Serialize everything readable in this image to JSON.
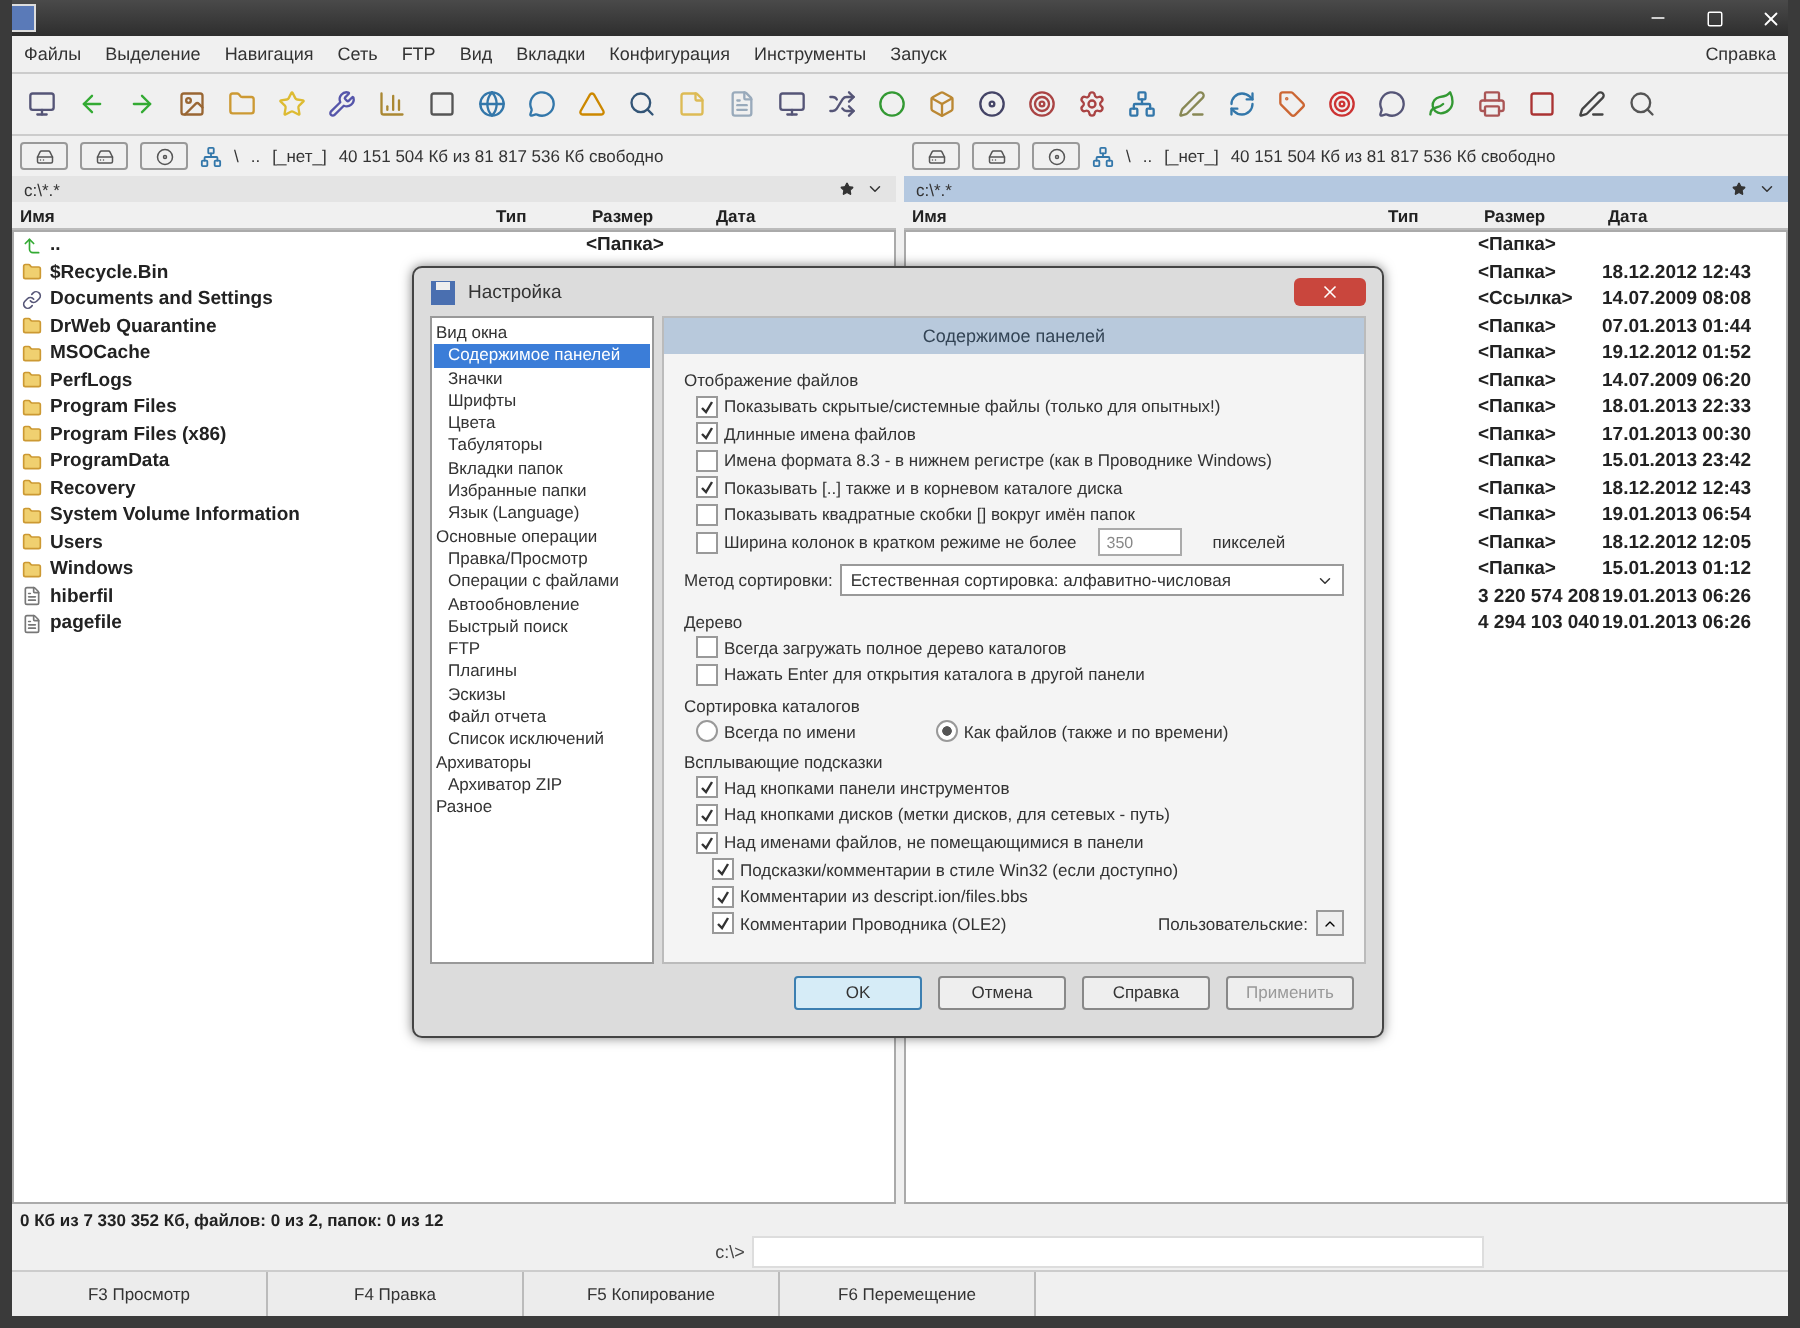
{
  "menu": [
    {
      "label": "Файлы"
    },
    {
      "label": "Выделение"
    },
    {
      "label": "Навигация"
    },
    {
      "label": "Сеть"
    },
    {
      "label": "FTP"
    },
    {
      "label": "Вид"
    },
    {
      "label": "Вкладки"
    },
    {
      "label": "Конфигурация"
    },
    {
      "label": "Инструменты"
    },
    {
      "label": "Запуск"
    }
  ],
  "help_menu": "Справка",
  "panels": [
    {
      "active": false,
      "no_drive": "[_нет_]",
      "root": "\\",
      "up": "..",
      "free": "40 151 504 Кб из 81 817 536 Кб свободно",
      "path": "c:\\*.*",
      "columns": [
        "Имя",
        "Тип",
        "Размер",
        "Дата"
      ],
      "rows": [
        {
          "kind": "up",
          "name": "..",
          "size": "<Папка>"
        },
        {
          "kind": "folder",
          "name": "$Recycle.Bin"
        },
        {
          "kind": "link",
          "name": "Documents and Settings"
        },
        {
          "kind": "folder",
          "name": "DrWeb Quarantine"
        },
        {
          "kind": "folder",
          "name": "MSOCache"
        },
        {
          "kind": "folder",
          "name": "PerfLogs"
        },
        {
          "kind": "folder",
          "name": "Program Files"
        },
        {
          "kind": "folder",
          "name": "Program Files (x86)"
        },
        {
          "kind": "folder",
          "name": "ProgramData"
        },
        {
          "kind": "folder",
          "name": "Recovery"
        },
        {
          "kind": "folder",
          "name": "System Volume Information"
        },
        {
          "kind": "folder",
          "name": "Users"
        },
        {
          "kind": "folder",
          "name": "Windows"
        },
        {
          "kind": "file",
          "name": "hiberfil"
        },
        {
          "kind": "file",
          "name": "pagefile"
        }
      ],
      "status": "0 Кб из 7 330 352 Кб, файлов: 0 из 2, папок: 0 из 12"
    },
    {
      "active": true,
      "no_drive": "[_нет_]",
      "root": "\\",
      "up": "..",
      "free": "40 151 504 Кб из 81 817 536 Кб свободно",
      "path": "c:\\*.*",
      "columns": [
        "Имя",
        "Тип",
        "Размер",
        "Дата"
      ],
      "rows": [
        {
          "size": "<Папка>"
        },
        {
          "size": "<Папка>",
          "date": "18.12.2012 12:43"
        },
        {
          "size": "<Ссылка>",
          "date": "14.07.2009 08:08"
        },
        {
          "size": "<Папка>",
          "date": "07.01.2013 01:44"
        },
        {
          "size": "<Папка>",
          "date": "19.12.2012 01:52"
        },
        {
          "size": "<Папка>",
          "date": "14.07.2009 06:20"
        },
        {
          "size": "<Папка>",
          "date": "18.01.2013 22:33"
        },
        {
          "size": "<Папка>",
          "date": "17.01.2013 00:30"
        },
        {
          "size": "<Папка>",
          "date": "15.01.2013 23:42"
        },
        {
          "size": "<Папка>",
          "date": "18.12.2012 12:43"
        },
        {
          "size": "<Папка>",
          "date": "19.01.2013 06:54"
        },
        {
          "size": "<Папка>",
          "date": "18.12.2012 12:05"
        },
        {
          "size": "<Папка>",
          "date": "15.01.2013 01:12"
        },
        {
          "size": "3 220 574 208",
          "date": "19.01.2013 06:26"
        },
        {
          "size": "4 294 103 040",
          "date": "19.01.2013 06:26"
        }
      ]
    }
  ],
  "command_prompt": "c:\\>",
  "function_keys": [
    "F3 Просмотр",
    "F4 Правка",
    "F5 Копирование",
    "F6 Перемещение"
  ],
  "dialog": {
    "title": "Настройка",
    "tree": [
      {
        "label": "Вид окна",
        "selected": false,
        "children": [
          {
            "label": "Содержимое панелей",
            "selected": true
          },
          {
            "label": "Значки",
            "selected": false
          },
          {
            "label": "Шрифты",
            "selected": false
          },
          {
            "label": "Цвета",
            "selected": false
          },
          {
            "label": "Табуляторы",
            "selected": false
          },
          {
            "label": "Вкладки папок",
            "selected": false
          },
          {
            "label": "Избранные папки",
            "selected": false
          },
          {
            "label": "Язык (Language)",
            "selected": false
          }
        ]
      },
      {
        "label": "Основные операции",
        "selected": false,
        "children": [
          {
            "label": "Правка/Просмотр",
            "selected": false
          },
          {
            "label": "Операции с файлами",
            "selected": false
          },
          {
            "label": "Автообновление",
            "selected": false
          },
          {
            "label": "Быстрый поиск",
            "selected": false
          },
          {
            "label": "FTP",
            "selected": false
          },
          {
            "label": "Плагины",
            "selected": false
          },
          {
            "label": "Эскизы",
            "selected": false
          },
          {
            "label": "Файл отчета",
            "selected": false
          },
          {
            "label": "Список исключений",
            "selected": false
          }
        ]
      },
      {
        "label": "Архиваторы",
        "selected": false,
        "children": [
          {
            "label": "Архиватор ZIP",
            "selected": false
          }
        ]
      },
      {
        "label": "Разное",
        "selected": false
      }
    ],
    "page_title": "Содержимое панелей",
    "items": [
      {
        "kind": "heading",
        "label": "Отображение файлов"
      },
      {
        "kind": "checkbox",
        "label": "Показывать скрытые/системные файлы (только для опытных!)",
        "checked": true
      },
      {
        "kind": "checkbox",
        "label": "Длинные имена файлов",
        "checked": true
      },
      {
        "kind": "checkbox",
        "label": "Имена формата 8.3 - в нижнем регистре (как в Проводнике Windows)",
        "checked": false
      },
      {
        "kind": "checkbox",
        "label": "Показывать [..] также и в корневом каталоге диска",
        "checked": true
      },
      {
        "kind": "checkbox",
        "label": "Показывать квадратные скобки [] вокруг имён папок",
        "checked": false
      },
      {
        "kind": "width",
        "label": "Ширина колонок в кратком режиме не более",
        "checked": false,
        "value": "350",
        "suffix": "пикселей"
      },
      {
        "kind": "select",
        "label": "Метод сортировки:",
        "value": "Естественная сортировка: алфавитно-числовая"
      },
      {
        "kind": "heading",
        "label": "Дерево"
      },
      {
        "kind": "checkbox",
        "label": "Всегда загружать полное дерево каталогов",
        "checked": false
      },
      {
        "kind": "checkbox",
        "label": "Нажать Enter для открытия каталога в другой панели",
        "checked": false
      },
      {
        "kind": "heading",
        "label": "Сортировка каталогов"
      },
      {
        "kind": "radios",
        "options": [
          {
            "label": "Всегда по имени",
            "selected": false
          },
          {
            "label": "Как файлов (также и по времени)",
            "selected": true
          }
        ]
      },
      {
        "kind": "heading",
        "label": "Всплывающие подсказки"
      },
      {
        "kind": "checkbox",
        "label": "Над кнопками панели инструментов",
        "checked": true
      },
      {
        "kind": "checkbox",
        "label": "Над кнопками дисков (метки дисков, для сетевых - путь)",
        "checked": true
      },
      {
        "kind": "checkbox",
        "label": "Над именами файлов, не помещающимися в панели",
        "checked": true,
        "children": [
          {
            "kind": "checkbox",
            "label": "Подсказки/комментарии в стиле Win32 (если доступно)",
            "checked": true
          },
          {
            "kind": "checkbox",
            "label": "Комментарии из descript.ion/files.bbs",
            "checked": true
          },
          {
            "kind": "checkbox",
            "label": "Комментарии Проводника (OLE2)",
            "checked": true,
            "aside": "Пользовательские:"
          }
        ]
      }
    ],
    "buttons": [
      {
        "label": "OK",
        "default": true,
        "disabled": false
      },
      {
        "label": "Отмена",
        "default": false,
        "disabled": false
      },
      {
        "label": "Справка",
        "default": false,
        "disabled": false
      },
      {
        "label": "Применить",
        "default": false,
        "disabled": true
      }
    ]
  }
}
